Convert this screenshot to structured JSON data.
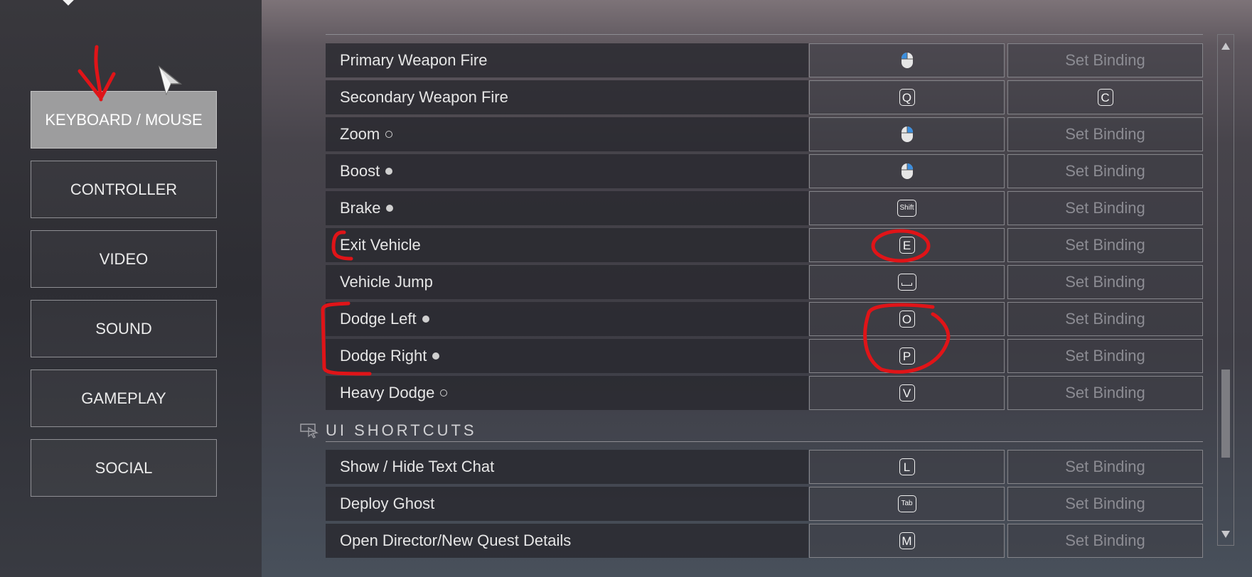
{
  "sidebar": {
    "items": [
      {
        "label": "KEYBOARD / MOUSE",
        "active": true
      },
      {
        "label": "CONTROLLER"
      },
      {
        "label": "VIDEO"
      },
      {
        "label": "SOUND"
      },
      {
        "label": "GAMEPLAY"
      },
      {
        "label": "SOCIAL"
      }
    ]
  },
  "bindings": {
    "set_binding_label": "Set Binding",
    "rows": [
      {
        "label": "Primary Weapon Fire",
        "primary_icon": "mouse-left-click-icon",
        "secondary": "Set Binding"
      },
      {
        "label": "Secondary Weapon Fire",
        "primary_key": "Q",
        "secondary_key": "C"
      },
      {
        "label": "Zoom",
        "indicator": "hollow-dot",
        "primary_icon": "mouse-right-click-icon",
        "secondary": "Set Binding"
      },
      {
        "label": "Boost",
        "indicator": "filled-dot",
        "primary_icon": "mouse-right-click-icon",
        "secondary": "Set Binding"
      },
      {
        "label": "Brake",
        "indicator": "filled-dot",
        "primary_key": "Shift",
        "secondary": "Set Binding"
      },
      {
        "label": "Exit Vehicle",
        "primary_key": "E",
        "secondary": "Set Binding"
      },
      {
        "label": "Vehicle Jump",
        "primary_icon": "spacebar-key-icon",
        "secondary": "Set Binding"
      },
      {
        "label": "Dodge Left",
        "indicator": "filled-dot",
        "primary_key": "O",
        "secondary": "Set Binding"
      },
      {
        "label": "Dodge Right",
        "indicator": "filled-dot",
        "primary_key": "P",
        "secondary": "Set Binding"
      },
      {
        "label": "Heavy Dodge",
        "indicator": "hollow-dot",
        "primary_key": "V",
        "secondary": "Set Binding"
      }
    ]
  },
  "ui_shortcuts": {
    "title": "UI SHORTCUTS",
    "rows": [
      {
        "label": "Show / Hide Text Chat",
        "primary_key": "L",
        "secondary": "Set Binding"
      },
      {
        "label": "Deploy Ghost",
        "primary_key": "Tab",
        "secondary": "Set Binding"
      },
      {
        "label": "Open Director/New Quest Details",
        "primary_key": "M",
        "secondary": "Set Binding"
      }
    ]
  },
  "colors": {
    "annotation": "#e01418",
    "active_tab": "#9d9d9e"
  },
  "annotations": [
    "red-arrow",
    "red-bracket",
    "red-circle"
  ]
}
